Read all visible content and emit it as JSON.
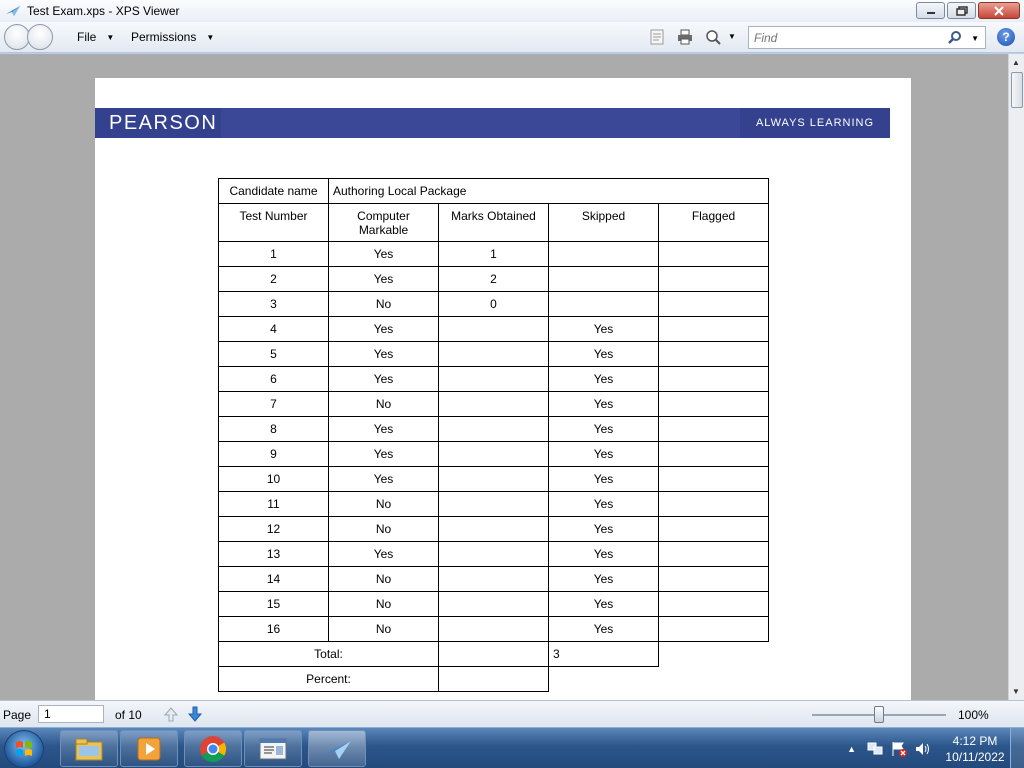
{
  "window": {
    "title": "Test Exam.xps - XPS Viewer"
  },
  "toolbar": {
    "file_label": "File",
    "permissions_label": "Permissions",
    "find_placeholder": "Find",
    "help_label": "?"
  },
  "document": {
    "banner_brand": "PEARSON",
    "banner_tagline": "ALWAYS LEARNING",
    "candidate_label": "Candidate name",
    "candidate_value": "Authoring Local Package",
    "headers": {
      "test_number": "Test Number",
      "computer_markable": "Computer Markable",
      "marks_obtained": "Marks Obtained",
      "skipped": "Skipped",
      "flagged": "Flagged"
    },
    "rows": [
      {
        "n": "1",
        "cm": "Yes",
        "marks": "1",
        "skipped": "",
        "flagged": ""
      },
      {
        "n": "2",
        "cm": "Yes",
        "marks": "2",
        "skipped": "",
        "flagged": ""
      },
      {
        "n": "3",
        "cm": "No",
        "marks": "0",
        "skipped": "",
        "flagged": ""
      },
      {
        "n": "4",
        "cm": "Yes",
        "marks": "",
        "skipped": "Yes",
        "flagged": ""
      },
      {
        "n": "5",
        "cm": "Yes",
        "marks": "",
        "skipped": "Yes",
        "flagged": ""
      },
      {
        "n": "6",
        "cm": "Yes",
        "marks": "",
        "skipped": "Yes",
        "flagged": ""
      },
      {
        "n": "7",
        "cm": "No",
        "marks": "",
        "skipped": "Yes",
        "flagged": ""
      },
      {
        "n": "8",
        "cm": "Yes",
        "marks": "",
        "skipped": "Yes",
        "flagged": ""
      },
      {
        "n": "9",
        "cm": "Yes",
        "marks": "",
        "skipped": "Yes",
        "flagged": ""
      },
      {
        "n": "10",
        "cm": "Yes",
        "marks": "",
        "skipped": "Yes",
        "flagged": ""
      },
      {
        "n": "11",
        "cm": "No",
        "marks": "",
        "skipped": "Yes",
        "flagged": ""
      },
      {
        "n": "12",
        "cm": "No",
        "marks": "",
        "skipped": "Yes",
        "flagged": ""
      },
      {
        "n": "13",
        "cm": "Yes",
        "marks": "",
        "skipped": "Yes",
        "flagged": ""
      },
      {
        "n": "14",
        "cm": "No",
        "marks": "",
        "skipped": "Yes",
        "flagged": ""
      },
      {
        "n": "15",
        "cm": "No",
        "marks": "",
        "skipped": "Yes",
        "flagged": ""
      },
      {
        "n": "16",
        "cm": "No",
        "marks": "",
        "skipped": "Yes",
        "flagged": ""
      }
    ],
    "total_label": "Total:",
    "total_marks": "",
    "total_value": "3",
    "percent_label": "Percent:",
    "percent_value": ""
  },
  "statusbar": {
    "page_label": "Page",
    "page_value": "1",
    "page_of": "of 10",
    "zoom": "100%",
    "zoom_level_fraction": 0.5
  },
  "taskbar": {
    "time": "4:12 PM",
    "date": "10/11/2022"
  },
  "icons": {
    "app": "xps-viewer-icon",
    "start": "windows-start-icon"
  },
  "colors": {
    "banner": "#3b4898",
    "viewer_bg": "#ababab"
  }
}
